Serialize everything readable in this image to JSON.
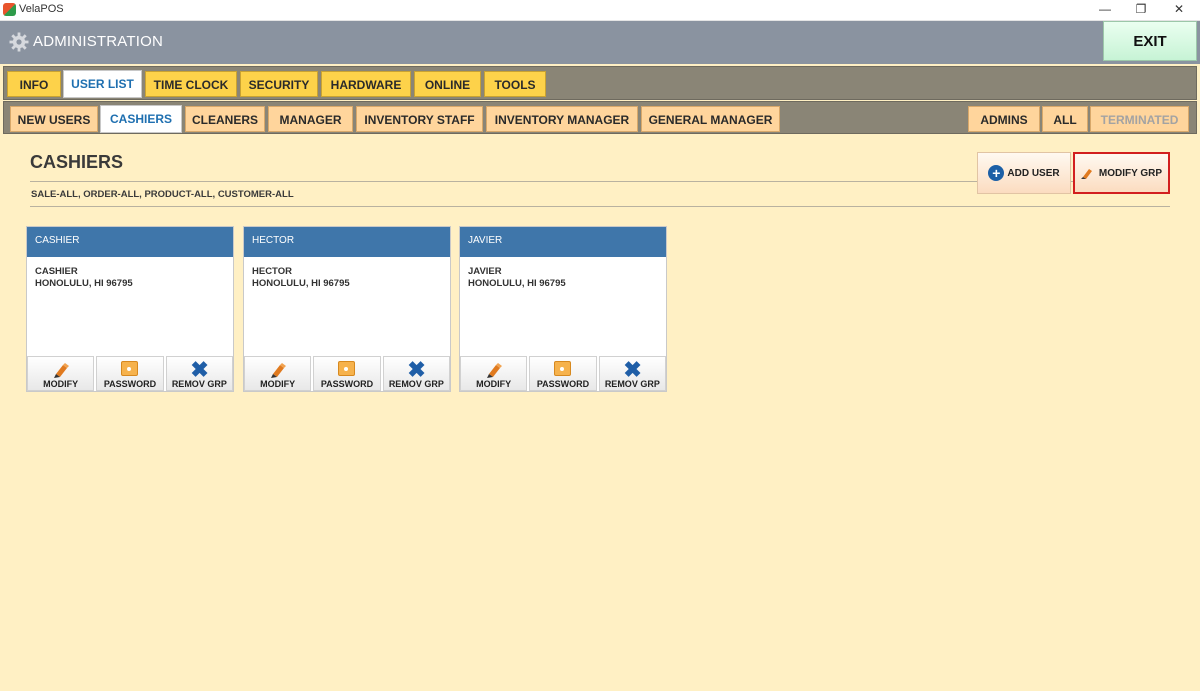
{
  "window": {
    "title": "VelaPOS",
    "minimize": "—",
    "restore": "❐",
    "close": "✕"
  },
  "header": {
    "title": "ADMINISTRATION",
    "exit_label": "EXIT"
  },
  "main_tabs": [
    {
      "label": "INFO"
    },
    {
      "label": "USER LIST",
      "active": true
    },
    {
      "label": "TIME CLOCK"
    },
    {
      "label": "SECURITY"
    },
    {
      "label": "HARDWARE"
    },
    {
      "label": "ONLINE"
    },
    {
      "label": "TOOLS"
    }
  ],
  "sub_tabs": [
    {
      "label": "NEW USERS"
    },
    {
      "label": "CASHIERS",
      "active": true
    },
    {
      "label": "CLEANERS"
    },
    {
      "label": "MANAGER"
    },
    {
      "label": "INVENTORY STAFF"
    },
    {
      "label": "INVENTORY MANAGER"
    },
    {
      "label": "GENERAL MANAGER"
    },
    {
      "label": "ADMINS"
    },
    {
      "label": "ALL"
    },
    {
      "label": "TERMINATED",
      "disabled": true
    }
  ],
  "page": {
    "title": "CASHIERS",
    "permissions": "SALE-ALL, ORDER-ALL, PRODUCT-ALL, CUSTOMER-ALL",
    "add_user_label": "ADD USER",
    "modify_grp_label": "MODIFY GRP"
  },
  "users": [
    {
      "header": "CASHIER",
      "name": "CASHIER",
      "location": "HONOLULU, HI 96795"
    },
    {
      "header": "HECTOR",
      "name": "HECTOR",
      "location": "HONOLULU, HI 96795"
    },
    {
      "header": "JAVIER",
      "name": "JAVIER",
      "location": "HONOLULU, HI 96795"
    }
  ],
  "card_actions": {
    "modify": "MODIFY",
    "password": "PASSWORD",
    "remove": "REMOV GRP"
  },
  "colors": {
    "background": "#fff0c4",
    "header": "#8a93a0",
    "card_header": "#3f76aa",
    "highlight_border": "#d21f1f"
  }
}
